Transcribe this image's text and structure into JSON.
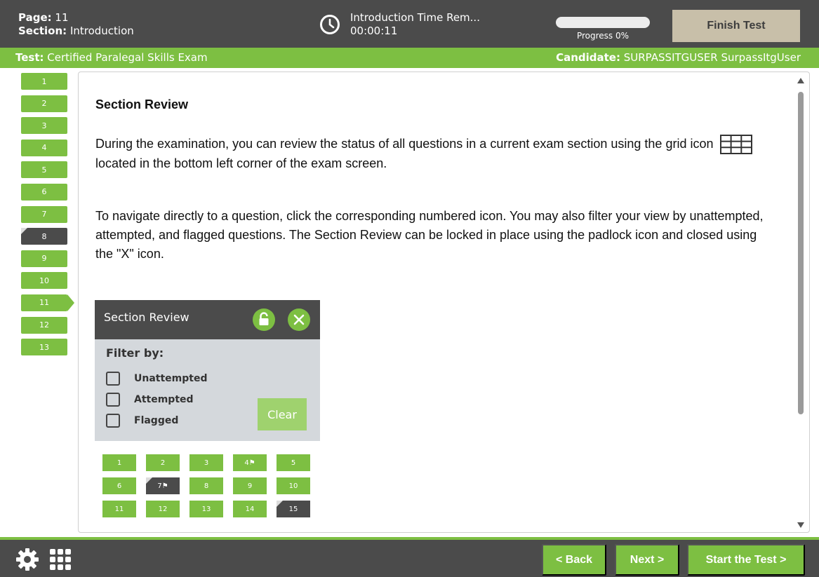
{
  "header": {
    "page_label": "Page:",
    "page_value": "11",
    "section_label": "Section:",
    "section_value": "Introduction",
    "timer_title": "Introduction Time Rem...",
    "timer_value": "00:00:11",
    "progress_label": "Progress 0%",
    "progress_percent": 0,
    "finish_button": "Finish Test",
    "clock_icon": "clock-icon"
  },
  "infobar": {
    "test_label": "Test:",
    "test_value": "Certified Paralegal Skills Exam",
    "candidate_label": "Candidate:",
    "candidate_value": "SURPASSITGUSER SurpassItgUser"
  },
  "question_nav": {
    "items": [
      {
        "label": "1",
        "state": "attempted"
      },
      {
        "label": "2",
        "state": "attempted"
      },
      {
        "label": "3",
        "state": "attempted"
      },
      {
        "label": "4",
        "state": "attempted"
      },
      {
        "label": "5",
        "state": "attempted"
      },
      {
        "label": "6",
        "state": "attempted"
      },
      {
        "label": "7",
        "state": "attempted"
      },
      {
        "label": "8",
        "state": "unattempted"
      },
      {
        "label": "9",
        "state": "attempted"
      },
      {
        "label": "10",
        "state": "attempted"
      },
      {
        "label": "11",
        "state": "current"
      },
      {
        "label": "12",
        "state": "attempted"
      },
      {
        "label": "13",
        "state": "attempted"
      }
    ]
  },
  "content": {
    "heading": "Section Review",
    "para1_a": "During the examination, you can review the status of all questions in a current exam section using the grid icon",
    "para1_b": "located in the bottom left corner of the exam screen.",
    "para2": "To navigate directly to a question, click the corresponding numbered icon. You may also filter your view by unattempted, attempted, and flagged questions. The Section Review can be locked in place using the padlock icon and closed using the \"X\" icon."
  },
  "illustration": {
    "title": "Section Review",
    "filter_title": "Filter by:",
    "options": [
      "Unattempted",
      "Attempted",
      "Flagged"
    ],
    "clear_label": "Clear",
    "cells": [
      {
        "label": "1",
        "dark": false
      },
      {
        "label": "2",
        "dark": false
      },
      {
        "label": "3",
        "dark": false
      },
      {
        "label": "4⚑",
        "dark": false
      },
      {
        "label": "5",
        "dark": false
      },
      {
        "label": "6",
        "dark": false
      },
      {
        "label": "7⚑",
        "dark": true
      },
      {
        "label": "8",
        "dark": false
      },
      {
        "label": "9",
        "dark": false
      },
      {
        "label": "10",
        "dark": false
      },
      {
        "label": "11",
        "dark": false
      },
      {
        "label": "12",
        "dark": false
      },
      {
        "label": "13",
        "dark": false
      },
      {
        "label": "14",
        "dark": false
      },
      {
        "label": "15",
        "dark": true
      }
    ]
  },
  "footer": {
    "back_label": "< Back",
    "next_label": "Next >",
    "start_label": "Start the Test >",
    "settings_icon": "gear-icon",
    "review_icon": "grid-icon"
  },
  "colors": {
    "green": "#7dbf42",
    "dark": "#4b4b4b",
    "finish": "#c8bfa9"
  }
}
